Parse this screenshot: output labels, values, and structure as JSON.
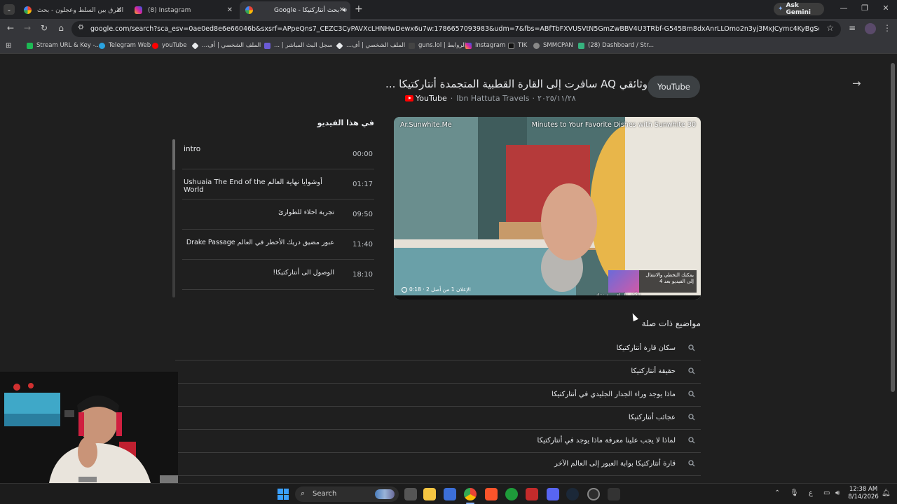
{
  "browser": {
    "tabs": [
      {
        "title": "الفرق بين السلط وعجلون - بحث",
        "favicon": "google-icon"
      },
      {
        "title": "(8) Instagram",
        "favicon": "instagram-icon"
      },
      {
        "title": "Google - بحث أنتاركتيكا",
        "favicon": "google-icon"
      }
    ],
    "new_tab": "+",
    "ask_gemini": "Ask Gemini",
    "url": "google.com/search?sca_esv=0ae0ed8e6e66046b&sxsrf=APpeQns7_CEZC3CyPAVXcLHNHwDewx6u7w:1786657093983&udm=7&fbs=ABfTbFXVUSVtN5GmZwBBV4U3TRbf-G545Bm8dxAnrLLOmo2n3yj3MxJCymc4KyBgSqkZnSCqeQcjYbsRBsOEjXOrP-E4..."
  },
  "bookmarks": [
    {
      "label": "Stream URL & Key -...",
      "color": "#1db954"
    },
    {
      "label": "Telegram Web",
      "color": "#2aa3e0"
    },
    {
      "label": "youTube",
      "color": "#ff0000"
    },
    {
      "label": "الملف الشخصي | أف...",
      "color": "#e8eaed"
    },
    {
      "label": "سجل البث المباشر | ...",
      "color": "#6b5bd6"
    },
    {
      "label": "الملف الشخصي | أف...",
      "color": "#e8eaed"
    },
    {
      "label": "guns.lol | الروابط",
      "color": "#444444"
    },
    {
      "label": "Instagram",
      "color": "#d6449a"
    },
    {
      "label": "TIK",
      "color": "#111111"
    },
    {
      "label": "SMMCPAN",
      "color": "#888888"
    },
    {
      "label": "(28) Dashboard / Str...",
      "color": "#36b37e"
    }
  ],
  "video": {
    "title": "وثائقي AQ سافرت إلى القارة القطبية المتجمدة أنتاركتيكا ...",
    "source": "YouTube",
    "channel": "Ibn Hattuta Travels",
    "date": "٢٠٢٥/١١/٢٨",
    "youtube_button": "YouTube",
    "ad_left": "Ar.Sunwhite.Me",
    "ad_right": "Minutes to Your Favorite Dishes with Sunwhite 30",
    "ad_info": "الإعلان 1 من أصل 2 · 0:18",
    "skip_text": "يمكنك التخطي والانتقال إلى الفيديو بعد 4",
    "skip_caption": "الأكل الراقي شفقك"
  },
  "chapters": {
    "heading": "في هذا الفيديو",
    "items": [
      {
        "title": "intro",
        "time": "00:00"
      },
      {
        "title": "أوشوايا نهاية العالم Ushuaia The End of the World",
        "time": "01:17"
      },
      {
        "title": "تجربة اخلاء للطوارئ",
        "time": "09:50"
      },
      {
        "title": "عبور مضيق دريك الأخطر في العالم Drake Passage",
        "time": "11:40"
      },
      {
        "title": "الوصول الى أنتاركتيكا!",
        "time": "18:10"
      }
    ]
  },
  "related": {
    "heading": "مواضيع ذات صلة",
    "items": [
      "سكان قارة أنتاركتيكا",
      "حقيقة أنتاركتيكا",
      "ماذا يوجد وراء الجدار الجليدي في أنتاركتيكا",
      "عجائب أنتاركتيكا",
      "لماذا لا يجب علينا معرفة ماذا يوجد في أنتاركتيكا",
      "قارة أنتاركتيكا بوابة العبور إلى العالم الآخر"
    ]
  },
  "taskbar": {
    "search_label": "Search",
    "lang": "ع",
    "time": "12:38 AM",
    "date": "8/14/2026"
  }
}
